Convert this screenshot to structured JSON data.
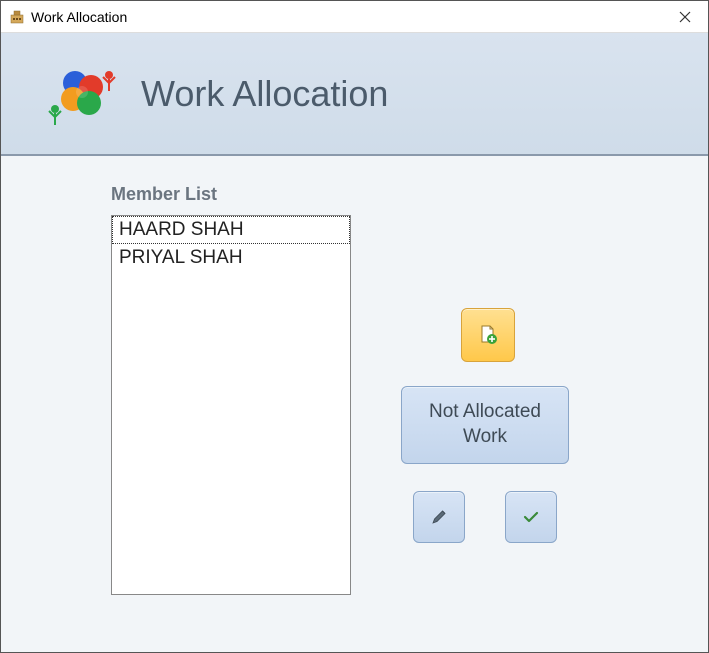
{
  "window": {
    "title": "Work Allocation"
  },
  "header": {
    "title": "Work Allocation"
  },
  "memberList": {
    "label": "Member List",
    "items": [
      "HAARD SHAH",
      "PRIYAL SHAH"
    ],
    "selectedIndex": 0
  },
  "buttons": {
    "notAllocated": "Not Allocated Work"
  }
}
